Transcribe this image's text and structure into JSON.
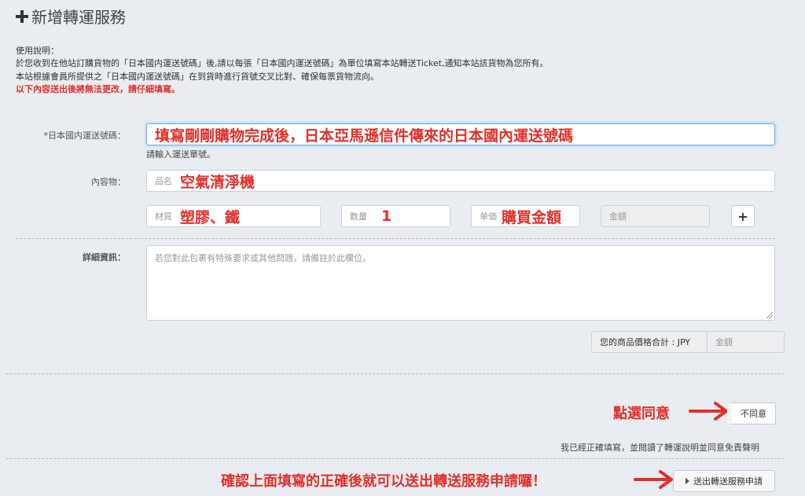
{
  "header": {
    "title": "新增轉運服務"
  },
  "instructions": {
    "heading": "使用說明：",
    "line1": "於您收到在他站訂購貨物的「日本國内運送號碼」後,請以每張「日本國内運送號碼」為單位填寫本站轉送Ticket,通知本站該貨物為您所有。",
    "line2": "本站根據會員所提供之「日本國内運送號碼」在到貨時進行貨號交叉比對、確保每票貨物流向。",
    "warning": "以下內容送出後將無法更改，請仔細填寫。"
  },
  "form": {
    "tracking_label": "*日本國内運送號碼：",
    "tracking_value": "填寫剛剛購物完成後，日本亞馬遜信件傳來的日本國內運送號碼",
    "tracking_hint": "請輸入運送單號。",
    "content_label": "內容物：",
    "item_name_prefix": "品名",
    "item_name_value": "空氣清淨機",
    "material_prefix": "材質",
    "material_value": "塑膠、鐵",
    "qty_prefix": "数量",
    "qty_value": "1",
    "unit_price_prefix": "单価",
    "unit_price_value": "購買金額",
    "amount_placeholder": "金額",
    "add_row_symbol": "+",
    "details_label": "詳細資訊：",
    "details_placeholder": "若您對此包裹有特殊要求或其他問題，請備註於此欄位。",
    "total_label": "您的商品價格合計 : JPY",
    "total_placeholder": "金額"
  },
  "agreement": {
    "annotation": "點選同意",
    "toggle_label": "不同意",
    "statement": "我已經正確填寫，並閱讀了轉運說明並同意免責聲明"
  },
  "submit": {
    "annotation": "確認上面填寫的正確後就可以送出轉送服務申請囉！",
    "button_label": "送出轉送服務申請"
  },
  "colors": {
    "accent_red": "#e0302a",
    "focus_blue": "#66afe9",
    "background": "#e9ecf0"
  }
}
